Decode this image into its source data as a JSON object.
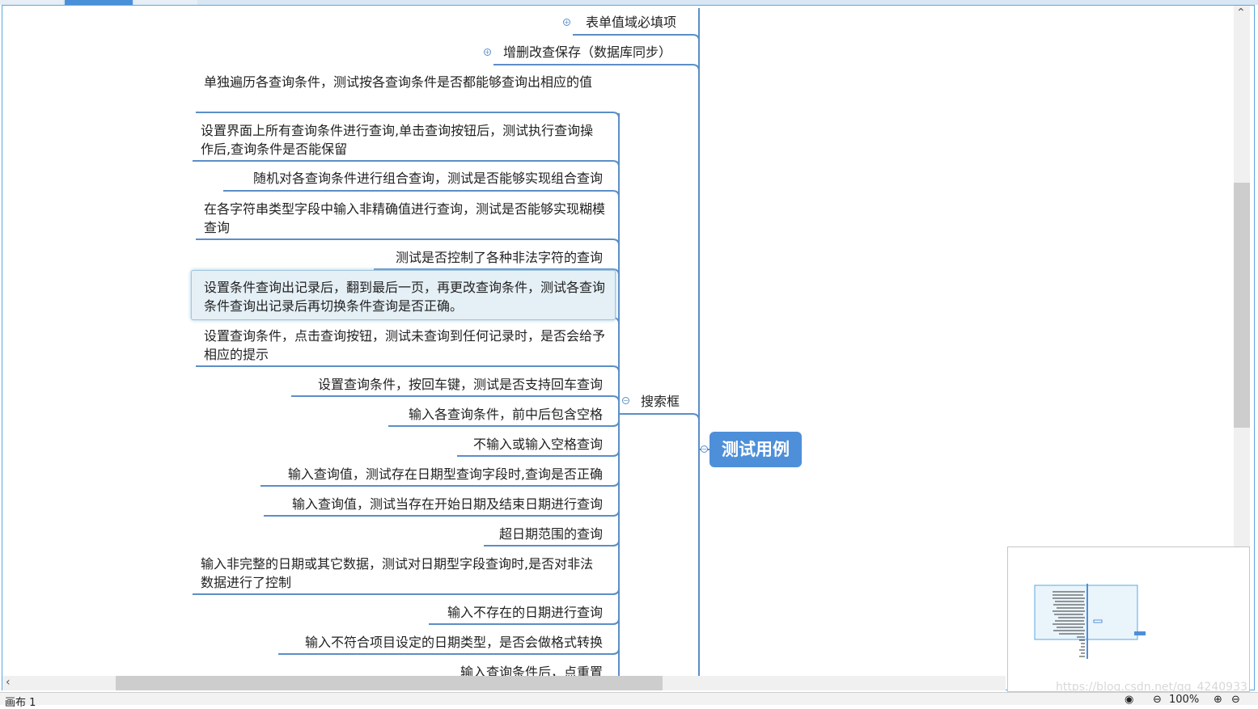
{
  "window": {
    "tabs": [
      "",
      "",
      ""
    ],
    "status_sheet_label": "画布 1",
    "zoom_label": "100%",
    "watermark": "https://blog.csdn.net/qq_4240933"
  },
  "mindmap": {
    "central_topic": "测试用例",
    "branch_topic": "搜索框",
    "sibling_topics": [
      "表单值域必填项",
      "增删改查保存（数据库同步）"
    ],
    "subtopics": [
      "单独遍历各查询条件，测试按各查询条件是否都能够查询出相应的值",
      "设置界面上所有查询条件进行查询,单击查询按钮后，测试执行查询操作后,查询条件是否能保留",
      "随机对各查询条件进行组合查询，测试是否能够实现组合查询",
      "在各字符串类型字段中输入非精确值进行查询，测试是否能够实现糊模查询",
      "测试是否控制了各种非法字符的查询",
      "设置条件查询出记录后，翻到最后一页，再更改查询条件，测试各查询条件查询出记录后再切换条件查询是否正确。",
      "设置查询条件，点击查询按钮，测试未查询到任何记录时，是否会给予相应的提示",
      "设置查询条件，按回车键，测试是否支持回车查询",
      "输入各查询条件，前中后包含空格",
      "不输入或输入空格查询",
      "输入查询值，测试存在日期型查询字段时,查询是否正确",
      "输入查询值，测试当存在开始日期及结束日期进行查询",
      "超日期范围的查询",
      "输入非完整的日期或其它数据，测试对日期型字段查询时,是否对非法数据进行了控制",
      "输入不存在的日期进行查询",
      "输入不符合项目设定的日期类型，是否会做格式转换",
      "输入查询条件后，点重置"
    ],
    "selected_index": 5
  },
  "colors": {
    "central_fill": "#4e8fd9",
    "connector": "#5b8ec7",
    "selection_fill": "#e5f0f6",
    "frame_border": "#58a8e0"
  }
}
